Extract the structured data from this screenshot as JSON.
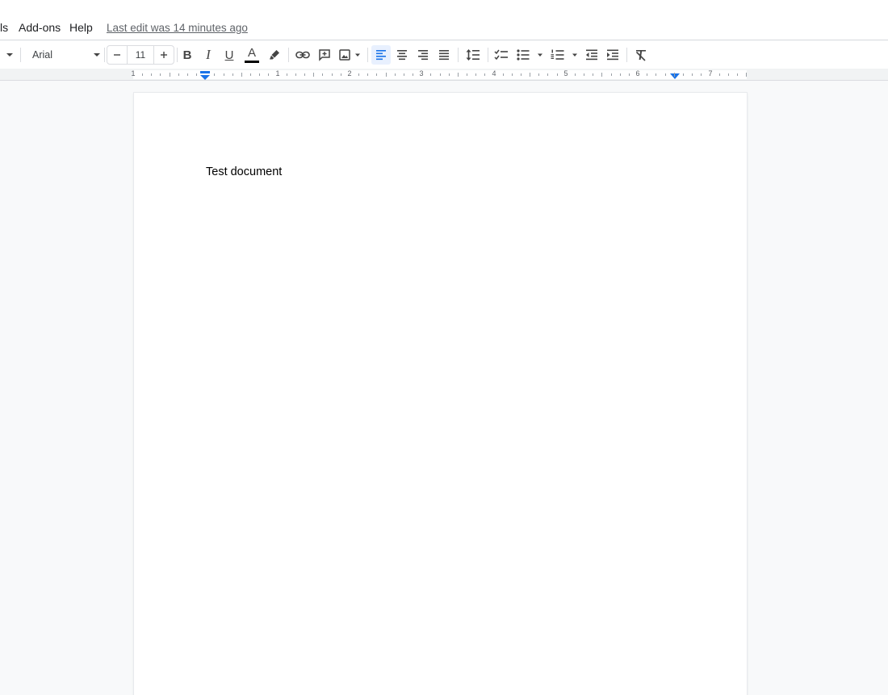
{
  "menu": {
    "tools_partial": "ls",
    "addons": "Add-ons",
    "help": "Help",
    "last_edit": "Last edit was 14 minutes ago"
  },
  "toolbar": {
    "font_name": "Arial",
    "font_size": "11",
    "bold": "B",
    "italic": "I",
    "underline": "U",
    "text_color": "A",
    "text_color_value": "#000000",
    "active_align": "left"
  },
  "ruler": {
    "labels": [
      "1",
      "1",
      "2",
      "3",
      "4",
      "5",
      "6",
      "7"
    ]
  },
  "document": {
    "body_text": "Test document"
  },
  "colors": {
    "accent": "#1a73e8",
    "active_bg": "#e8f0fe",
    "icon": "#444746"
  }
}
